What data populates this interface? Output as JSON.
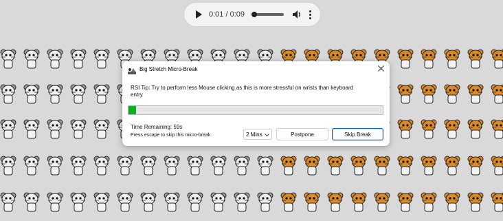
{
  "audio_player": {
    "time": "0:01 / 0:09",
    "icons": [
      "play-icon",
      "volume-icon",
      "more-options-icon"
    ]
  },
  "background": {
    "pattern": "hamster illustrations",
    "colors": {
      "page": "#d9d9d9",
      "orange_hamster": "#d98a2b",
      "gray_hamster": "#9a9a9a"
    }
  },
  "dialog": {
    "title": "Big Stretch Micro-Break",
    "tip": "RSI Tip: Try to perform less Mouse clicking as this is more stressful on wrists than keyboard entry",
    "progress_fraction": 0.03,
    "progress_color": "#06b025",
    "time_remaining": "Time Remaining: 59s",
    "escape_hint": "Press escape to skip this micro-break",
    "postpone_duration": "2 Mins",
    "postpone_label": "Postpone",
    "skip_label": "Skip Break",
    "accent": "#0067c0"
  }
}
